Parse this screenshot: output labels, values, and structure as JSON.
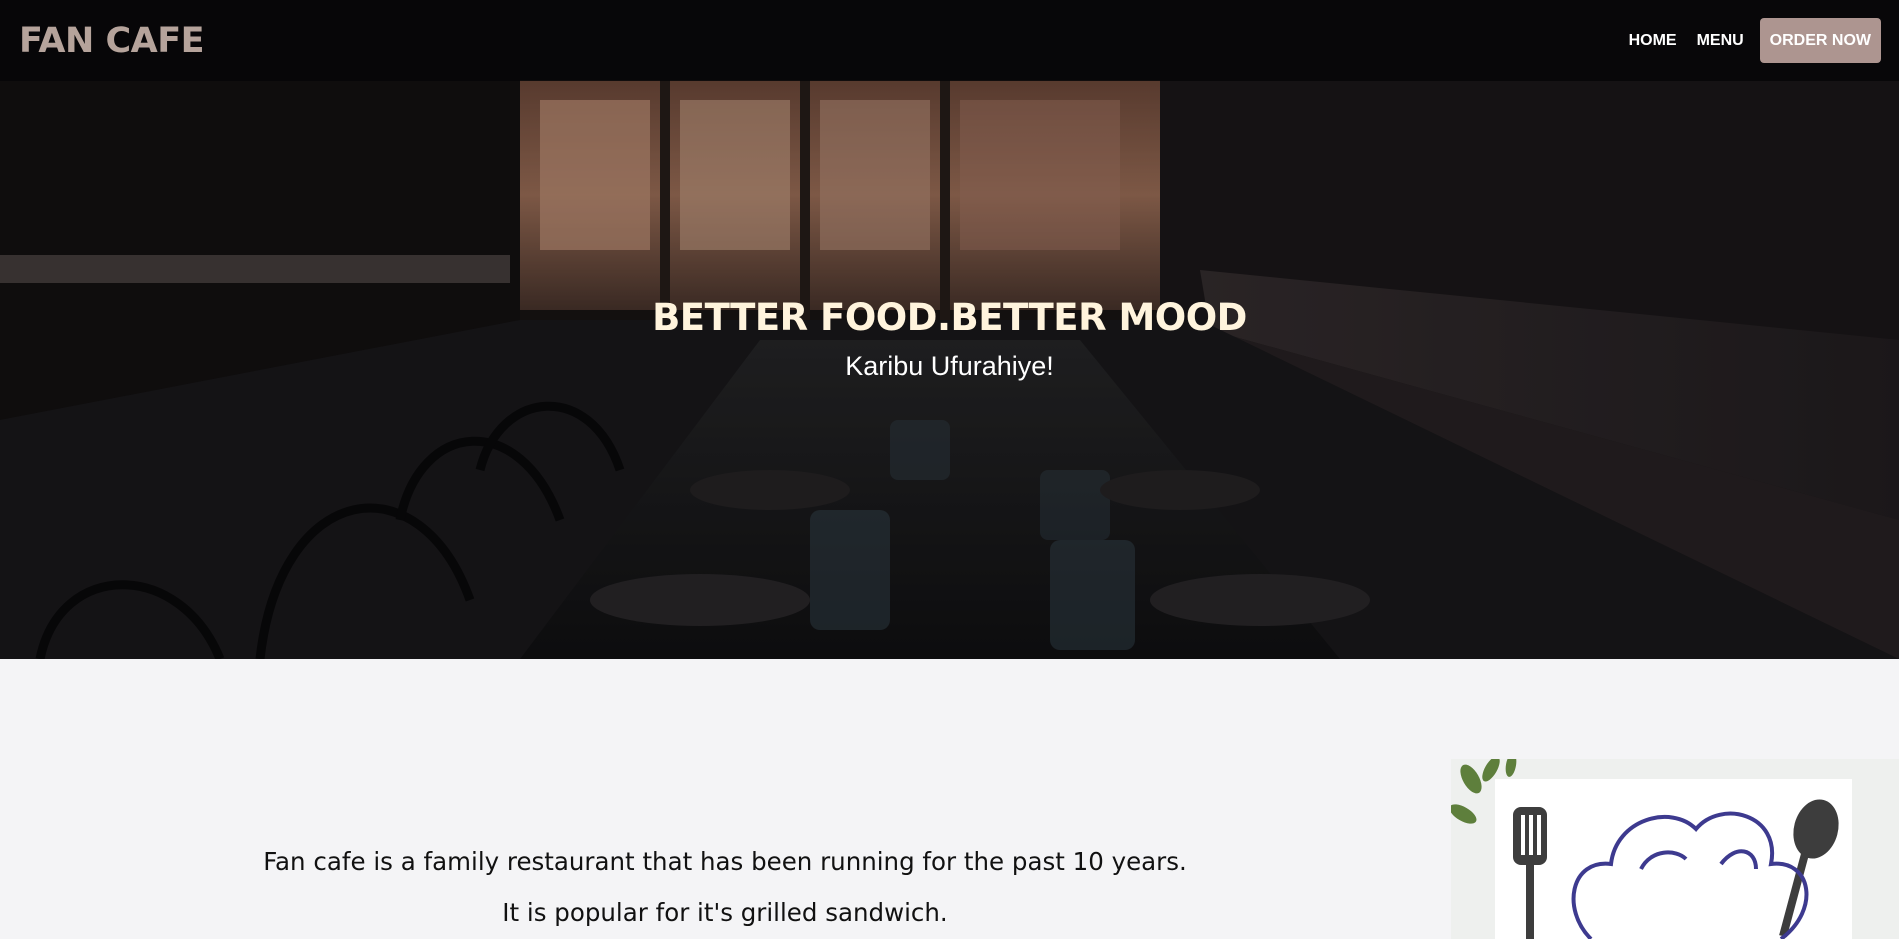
{
  "navbar": {
    "brand": "FAN CAFE",
    "links": [
      "HOME",
      "MENU"
    ],
    "cta": "ORDER NOW"
  },
  "hero": {
    "title": "BETTER FOOD.BETTER MOOD",
    "subtitle": "Karibu Ufurahiye!"
  },
  "about": {
    "lines": [
      "Fan cafe is a family restaurant that has been running for the past 10 years.",
      "It is popular for it's grilled sandwich."
    ]
  },
  "colors": {
    "brand": "#b5a39b",
    "cta_bg": "#ad9590",
    "hero_title": "#fff4dd",
    "page_bg": "#f4f4f6",
    "chef_outline": "#3d3a8f"
  },
  "icons": [
    "restaurant-interior-image",
    "chef-hat-illustration",
    "spatula-icon",
    "spoon-icon"
  ]
}
